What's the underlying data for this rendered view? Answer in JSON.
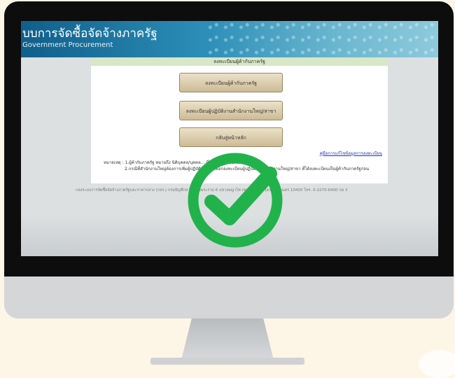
{
  "banner": {
    "title": "บบการจัดซื้อจัดจ้างภาครัฐ",
    "subtitle": "Government Procurement"
  },
  "panel": {
    "header": "ลงทะเบียนผู้ค้ากับภาครัฐ",
    "buttons": [
      "ลงทะเบียนผู้ค้ากับภาครัฐ",
      "ลงทะเบียนผู้ปฏิบัติงานสำนักงานใหญ่/สาขา",
      "กลับสู่หน้าหลัก"
    ],
    "manual_link": "คู่มือการแก้ไขข้อมูลการลงทะเบียน",
    "note_line1": "หมายเหตุ : 1.ผู้ค้ากับภาครัฐ หมายถึง นิติบุคคล/บุคคล... ที่มีความประสงค์จะ...",
    "note_line2": "2.กรณีที่สำนักงานใหญ่ต้องการเพิ่มผู้ปฏิบัติงาน ให้เลือกลงทะเบียนผู้ปฏิบัติงานสำนักงานใหญ่/สาขา ที่ได้ลงทะเบียนเป็นผู้ค้ากับภาครัฐก่อน"
  },
  "footer": {
    "text": "กองระบบการจัดซื้อจัดจ้างภาครัฐและราคากลาง (กจร.) กรมบัญชีกลาง ถนนพระราม 6 แขวงพญาไท เขตพญาไท กรุงเทพมหานคร 10400 โทร. 0-2270-6400 กด 3"
  },
  "overlay": {
    "icon": "check-circle-icon",
    "color": "#22b24c"
  }
}
